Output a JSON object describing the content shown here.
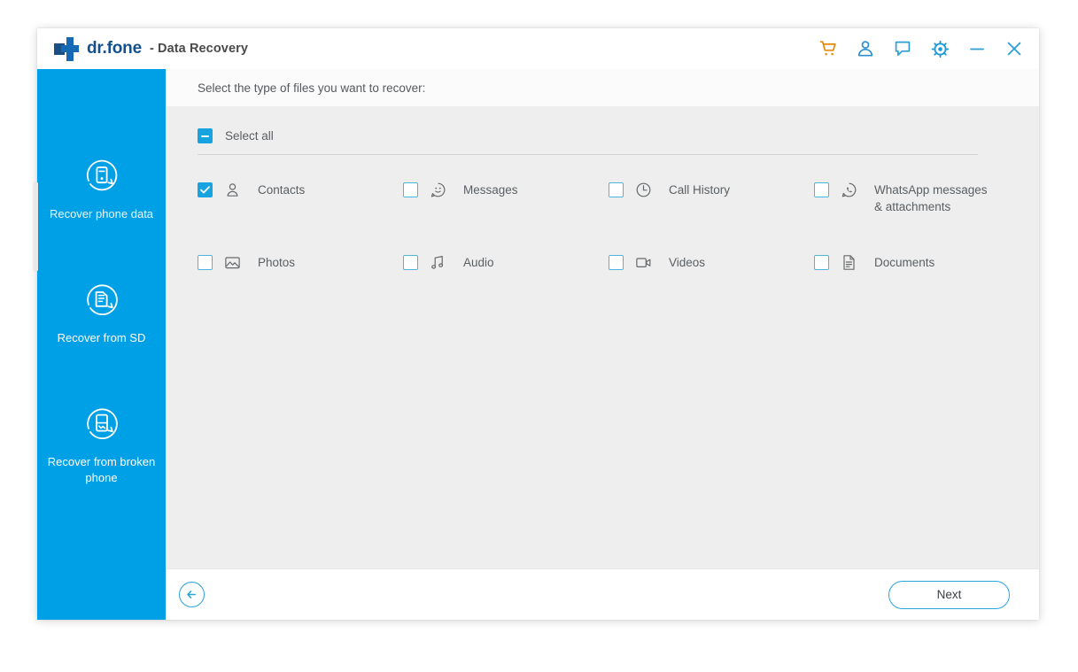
{
  "window": {
    "brand_name": "dr.fone",
    "brand_suffix": "- Data Recovery"
  },
  "titlebar_icons": [
    {
      "name": "cart-icon",
      "label": "Shopping cart",
      "color": "#e8870f"
    },
    {
      "name": "account-icon",
      "label": "Account",
      "color": "#2b8fd0"
    },
    {
      "name": "feedback-icon",
      "label": "Feedback",
      "color": "#2b9fd9"
    },
    {
      "name": "settings-gear-icon",
      "label": "Settings",
      "color": "#1a9bd7"
    },
    {
      "name": "minimize-icon",
      "label": "Minimize",
      "color": "#2b9fd9"
    },
    {
      "name": "close-icon",
      "label": "Close",
      "color": "#2b9fd9"
    }
  ],
  "sidebar": {
    "accent_color": "#00a0e6",
    "items": [
      {
        "label": "Recover phone data",
        "icon": "recover-phone-icon",
        "active": true
      },
      {
        "label": "Recover from SD",
        "icon": "recover-sd-icon",
        "active": false
      },
      {
        "label": "Recover from broken phone",
        "icon": "recover-broken-phone-icon",
        "active": false
      }
    ]
  },
  "main": {
    "instruction": "Select the type of files you want to recover:",
    "select_all": {
      "label": "Select all",
      "state": "indeterminate"
    },
    "file_types": [
      [
        {
          "label": "Contacts",
          "icon": "contacts-icon",
          "checked": true
        },
        {
          "label": "Messages",
          "icon": "messages-icon",
          "checked": false
        },
        {
          "label": "Call History",
          "icon": "call-history-icon",
          "checked": false
        },
        {
          "label": "WhatsApp messages\n& attachments",
          "icon": "whatsapp-icon",
          "checked": false
        }
      ],
      [
        {
          "label": "Photos",
          "icon": "photos-icon",
          "checked": false
        },
        {
          "label": "Audio",
          "icon": "audio-icon",
          "checked": false
        },
        {
          "label": "Videos",
          "icon": "videos-icon",
          "checked": false
        },
        {
          "label": "Documents",
          "icon": "documents-icon",
          "checked": false
        }
      ]
    ]
  },
  "footer": {
    "back_label": "Back",
    "next_label": "Next"
  },
  "colors": {
    "accent_blue": "#00a0e6",
    "checkbox_blue": "#17a3e0",
    "brand_dark_blue": "#14508c",
    "cart_orange": "#e8870f",
    "panel_gray": "#eeeeee"
  }
}
